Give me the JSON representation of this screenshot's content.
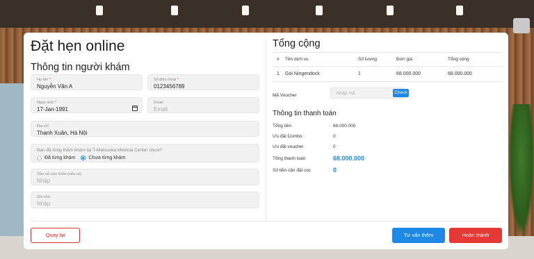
{
  "modal": {
    "title": "Đặt hẹn online",
    "patient_section": "Thông tin người khám",
    "fields": {
      "name_label": "Họ tên",
      "name_value": "Nguyễn Văn A",
      "phone_label": "Số điện thoại",
      "phone_value": "0123456789",
      "dob_label": "Ngày sinh",
      "dob_value": "17-Jan-1991",
      "email_label": "Email",
      "email_placeholder": "Email",
      "address_label": "Địa chỉ",
      "address_value": "Thanh Xuân, Hà Nội",
      "visited_question": "Bạn đã từng thăm khám tại T-Matsuoka Medical Center chưa?",
      "visited_option_yes": "Đã từng khám",
      "visited_option_no": "Chưa từng khám",
      "visited_selected": "Chưa từng khám",
      "history_label": "Tiền sử sức khỏe (nếu có)",
      "history_placeholder": "Nhập",
      "note_label": "Ghi chú",
      "note_placeholder": "Nhập"
    },
    "required_mark": "*"
  },
  "summary": {
    "title": "Tổng cộng",
    "columns": [
      "#",
      "Tên dịch vụ",
      "Số lượng",
      "Đơn giá",
      "Tổng cộng"
    ],
    "rows": [
      {
        "no": "1",
        "service": "Gói Ningendock",
        "qty": "1",
        "price": "68.000.000",
        "total": "68.000.000"
      }
    ],
    "voucher_label": "Mã Voucher",
    "voucher_placeholder": "Nhập mã",
    "voucher_button": "Check"
  },
  "payment": {
    "title": "Thông tin thanh toán",
    "total_label": "Tổng tiền",
    "total_value": "68.000.000",
    "combo_label": "Ưu đãi Combo",
    "combo_value": "0",
    "voucher_discount_label": "Ưu đãi voucher",
    "voucher_discount_value": "0",
    "grand_total_label": "Tổng thanh toán",
    "grand_total_value": "68.000.000",
    "deposit_label": "Số tiền cần đặt cọc",
    "deposit_value": "0"
  },
  "actions": {
    "back": "Quay lại",
    "consult": "Tư vấn thêm",
    "finish": "Hoàn thành"
  },
  "colors": {
    "accent": "#1e88e5",
    "danger": "#e53935"
  }
}
